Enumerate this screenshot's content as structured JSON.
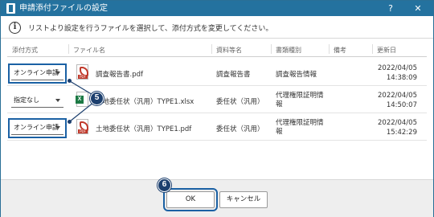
{
  "window": {
    "title": "申請添付ファイルの設定",
    "help": "?",
    "close": "✕"
  },
  "info": {
    "icon": "info-icon",
    "text": "リストより設定を行うファイルを選択して、添付方式を変更してください。"
  },
  "columns": {
    "method": "添付方式",
    "file_name": "ファイル名",
    "doc_name": "資料等名",
    "doc_type": "書類種別",
    "remarks": "備考",
    "updated": "更新日"
  },
  "rows": [
    {
      "method": "オンライン申請",
      "icon": "pdf-icon",
      "icon_label": "PDF",
      "file_name": "調査報告書.pdf",
      "doc_name": "調査報告書",
      "doc_type": "調査報告情報",
      "date": "2022/04/05",
      "time": "14:38:09"
    },
    {
      "method": "指定なし",
      "icon": "excel-icon",
      "icon_label": "X",
      "file_name": "土地委任状（汎用）TYPE1.xlsx",
      "doc_name": "委任状（汎用）",
      "doc_type": "代理権限証明情報",
      "date": "2022/04/05",
      "time": "14:50:07"
    },
    {
      "method": "オンライン申請",
      "icon": "pdf-icon",
      "icon_label": "PDF",
      "file_name": "土地委任状（汎用）TYPE1.pdf",
      "doc_name": "委任状（汎用）",
      "doc_type": "代理権限証明情報",
      "date": "2022/04/05",
      "time": "15:42:29"
    }
  ],
  "buttons": {
    "ok": "OK",
    "cancel": "キャンセル"
  },
  "markers": {
    "five": "5",
    "six": "6"
  },
  "colors": {
    "titlebar": "#24729f",
    "highlight": "#1b61a4",
    "marker": "#1c3f6e",
    "pdf": "#c0392b",
    "excel": "#1d7a45"
  }
}
